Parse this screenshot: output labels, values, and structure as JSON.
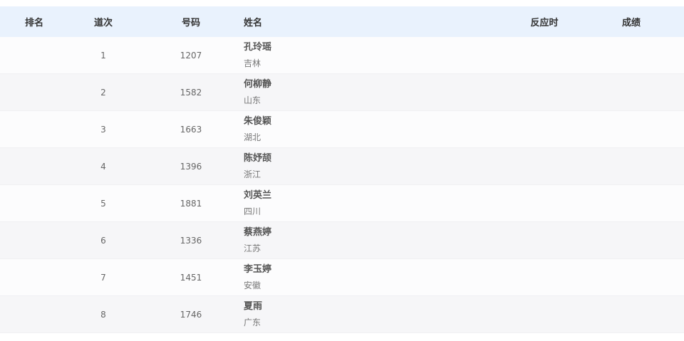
{
  "header": {
    "rank": "排名",
    "lane": "道次",
    "number": "号码",
    "name": "姓名",
    "reaction": "反应时",
    "result": "成绩"
  },
  "rows": [
    {
      "rank": "",
      "lane": "1",
      "number": "1207",
      "name": "孔玲瑶",
      "region": "吉林",
      "reaction": "",
      "result": ""
    },
    {
      "rank": "",
      "lane": "2",
      "number": "1582",
      "name": "何柳静",
      "region": "山东",
      "reaction": "",
      "result": ""
    },
    {
      "rank": "",
      "lane": "3",
      "number": "1663",
      "name": "朱俊颖",
      "region": "湖北",
      "reaction": "",
      "result": ""
    },
    {
      "rank": "",
      "lane": "4",
      "number": "1396",
      "name": "陈妤颉",
      "region": "浙江",
      "reaction": "",
      "result": ""
    },
    {
      "rank": "",
      "lane": "5",
      "number": "1881",
      "name": "刘英兰",
      "region": "四川",
      "reaction": "",
      "result": ""
    },
    {
      "rank": "",
      "lane": "6",
      "number": "1336",
      "name": "蔡燕婷",
      "region": "江苏",
      "reaction": "",
      "result": ""
    },
    {
      "rank": "",
      "lane": "7",
      "number": "1451",
      "name": "李玉婷",
      "region": "安徽",
      "reaction": "",
      "result": ""
    },
    {
      "rank": "",
      "lane": "8",
      "number": "1746",
      "name": "夏雨",
      "region": "广东",
      "reaction": "",
      "result": ""
    }
  ]
}
